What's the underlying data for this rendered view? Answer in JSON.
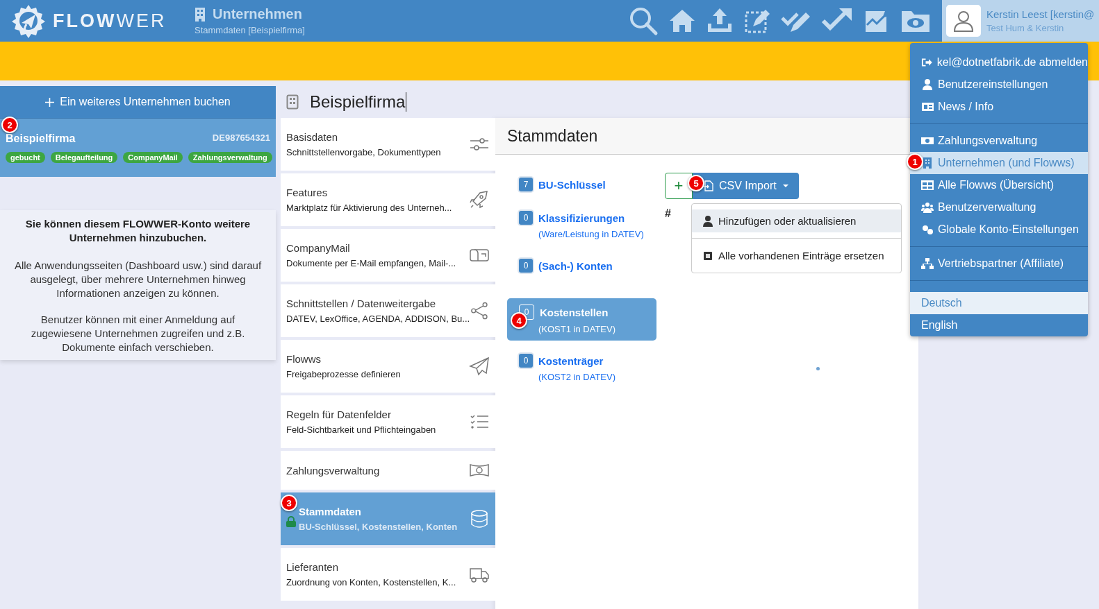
{
  "header": {
    "logo": "**FLOW**WER",
    "title": "Unternehmen",
    "subtitle": "Stammdaten [Beispielfirma]",
    "user": {
      "name": "Kerstin Leest [kerstin@",
      "org": "Test Hum & Kerstin"
    }
  },
  "left": {
    "book_button": "Ein weiteres Unternehmen buchen",
    "company": {
      "name": "Beispielfirma",
      "vat": "DE987654321",
      "selected": true,
      "tags": [
        "gebucht",
        "Belegaufteilung",
        "CompanyMail",
        "Zahlungsverwaltung"
      ]
    },
    "info": {
      "heading": "Sie können diesem FLOWWER-Konto weitere Unternehmen hinzubuchen.",
      "paragraphs": [
        "Alle Anwendungsseiten (Dashboard usw.) sind darauf ausgelegt, über mehrere Unternehmen hinweg Informationen anzeigen zu können.",
        "Benutzer können mit einer Anmeldung auf zugewiesene Unternehmen zugreifen und z.B. Dokumente einfach verschieben."
      ]
    }
  },
  "page_title": "Beispielfirma",
  "sections": [
    {
      "title": "Basisdaten",
      "subtitle": "Schnittstellenvorgabe, Dokumenttypen",
      "selected": false,
      "locked": false
    },
    {
      "title": "Features",
      "subtitle": "Marktplatz für Aktivierung des Unterneh...",
      "selected": false,
      "locked": false
    },
    {
      "title": "CompanyMail",
      "subtitle": "Dokumente per E-Mail empfangen, Mail-...",
      "selected": false,
      "locked": false
    },
    {
      "title": "Schnittstellen / Datenweitergabe",
      "subtitle": "DATEV, LexOffice, AGENDA, ADDISON, Bu...",
      "selected": false,
      "locked": false
    },
    {
      "title": "Flowws",
      "subtitle": "Freigabeprozesse definieren",
      "selected": false,
      "locked": false
    },
    {
      "title": "Regeln für Datenfelder",
      "subtitle": "Feld-Sichtbarkeit und Pflichteingaben",
      "selected": false,
      "locked": false
    },
    {
      "title": "Zahlungsverwaltung",
      "selected": false,
      "locked": false
    },
    {
      "title": "Stammdaten",
      "subtitle": "BU-Schlüssel, Kostenstellen, Konten",
      "selected": true,
      "locked": true
    },
    {
      "title": "Lieferanten",
      "subtitle": "Zuordnung von Konten, Kostenstellen, K...",
      "selected": false,
      "locked": false
    }
  ],
  "content": {
    "title": "Stammdaten",
    "items": [
      {
        "count": "7",
        "label": "BU-Schlüssel",
        "selected": false
      },
      {
        "count": "0",
        "label": "Klassifizierungen",
        "note": "(Ware/Leistung in DATEV)",
        "selected": false
      },
      {
        "count": "0",
        "label": "(Sach-) Konten",
        "selected": false
      },
      {
        "count": "0",
        "label": "Kostenstellen",
        "note": "(KOST1 in DATEV)",
        "selected": true
      },
      {
        "count": "0",
        "label": "Kostenträger",
        "note": "(KOST2 in DATEV)",
        "selected": false
      }
    ],
    "add_button": "+",
    "csv_button": "CSV Import",
    "hash": "#",
    "csv_menu": [
      {
        "label": "Hinzufügen oder aktualisieren",
        "selected": true
      },
      {
        "label": "Alle vorhandenen Einträge ersetzen",
        "selected": false
      }
    ]
  },
  "user_menu": {
    "groups": [
      [
        {
          "label": "kel@dotnetfabrik.de abmelden",
          "selected": false
        },
        {
          "label": "Benutzereinstellungen",
          "selected": false
        },
        {
          "label": "News / Info",
          "selected": false
        }
      ],
      [
        {
          "label": "Zahlungsverwaltung",
          "selected": false
        },
        {
          "label": "Unternehmen (und Flowws)",
          "selected": true
        },
        {
          "label": "Alle Flowws (Übersicht)",
          "selected": false
        },
        {
          "label": "Benutzerverwaltung",
          "selected": false
        },
        {
          "label": "Globale Konto-Einstellungen",
          "selected": false
        }
      ],
      [
        {
          "label": "Vertriebspartner (Affiliate)",
          "selected": false
        }
      ]
    ],
    "languages": [
      {
        "label": "Deutsch",
        "selected": true
      },
      {
        "label": "English",
        "selected": false
      }
    ]
  },
  "markers": [
    "1",
    "2",
    "3",
    "4",
    "5"
  ]
}
